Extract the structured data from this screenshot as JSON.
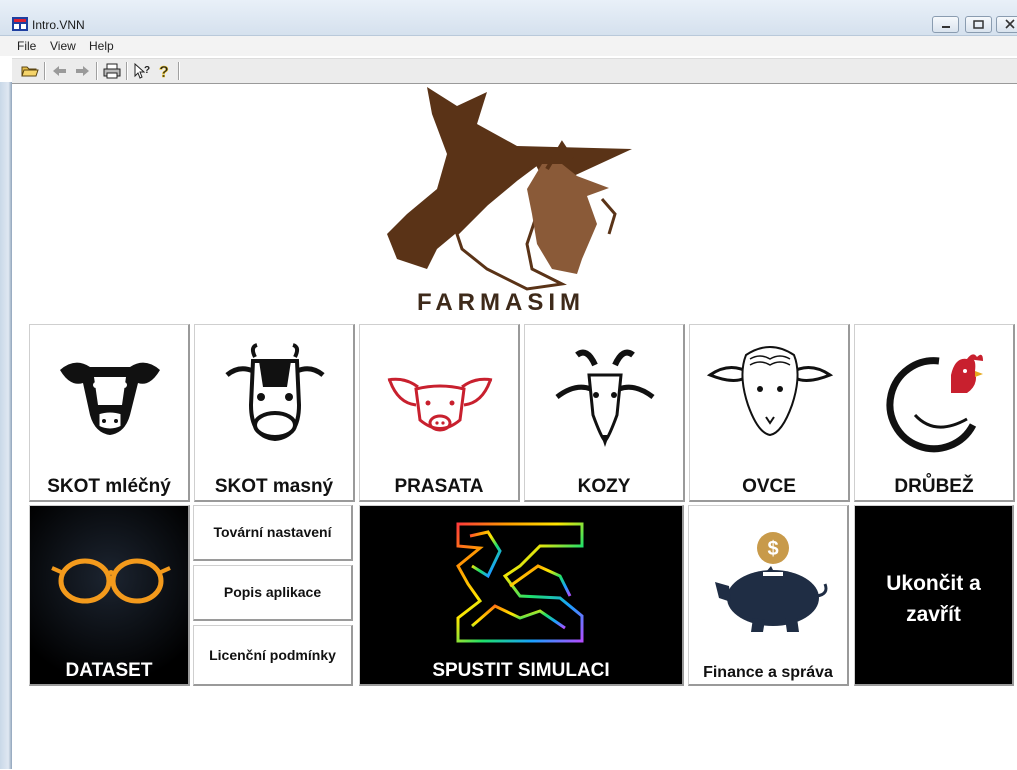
{
  "window": {
    "title": "Intro.VNN"
  },
  "menu": {
    "items": [
      "File",
      "View",
      "Help"
    ]
  },
  "toolbar": {
    "icons": [
      "open-folder-icon",
      "back-arrow-icon",
      "forward-arrow-icon",
      "print-icon",
      "context-help-icon",
      "help-icon"
    ]
  },
  "logo": {
    "text": "FARMASIM"
  },
  "animals": [
    {
      "label": "SKOT mléčný",
      "icon": "dairy-cow-icon"
    },
    {
      "label": "SKOT masný",
      "icon": "beef-cow-icon"
    },
    {
      "label": "PRASATA",
      "icon": "pig-icon"
    },
    {
      "label": "KOZY",
      "icon": "goat-icon"
    },
    {
      "label": "OVCE",
      "icon": "sheep-icon"
    },
    {
      "label": "DRŮBEŽ",
      "icon": "rooster-icon"
    }
  ],
  "actions": {
    "dataset": "DATASET",
    "factory": "Tovární nastavení",
    "about": "Popis aplikace",
    "license": "Licenční podmínky",
    "simulate": "SPUSTIT SIMULACI",
    "finance": "Finance a správa",
    "exit": "Ukončit a zavřít"
  },
  "colors": {
    "accent_red": "#c8202e",
    "logo_brown": "#6b3f1f",
    "glasses_orange": "#f39a1c",
    "coin_gold": "#c89a4a",
    "pig_navy": "#1f2d44"
  }
}
